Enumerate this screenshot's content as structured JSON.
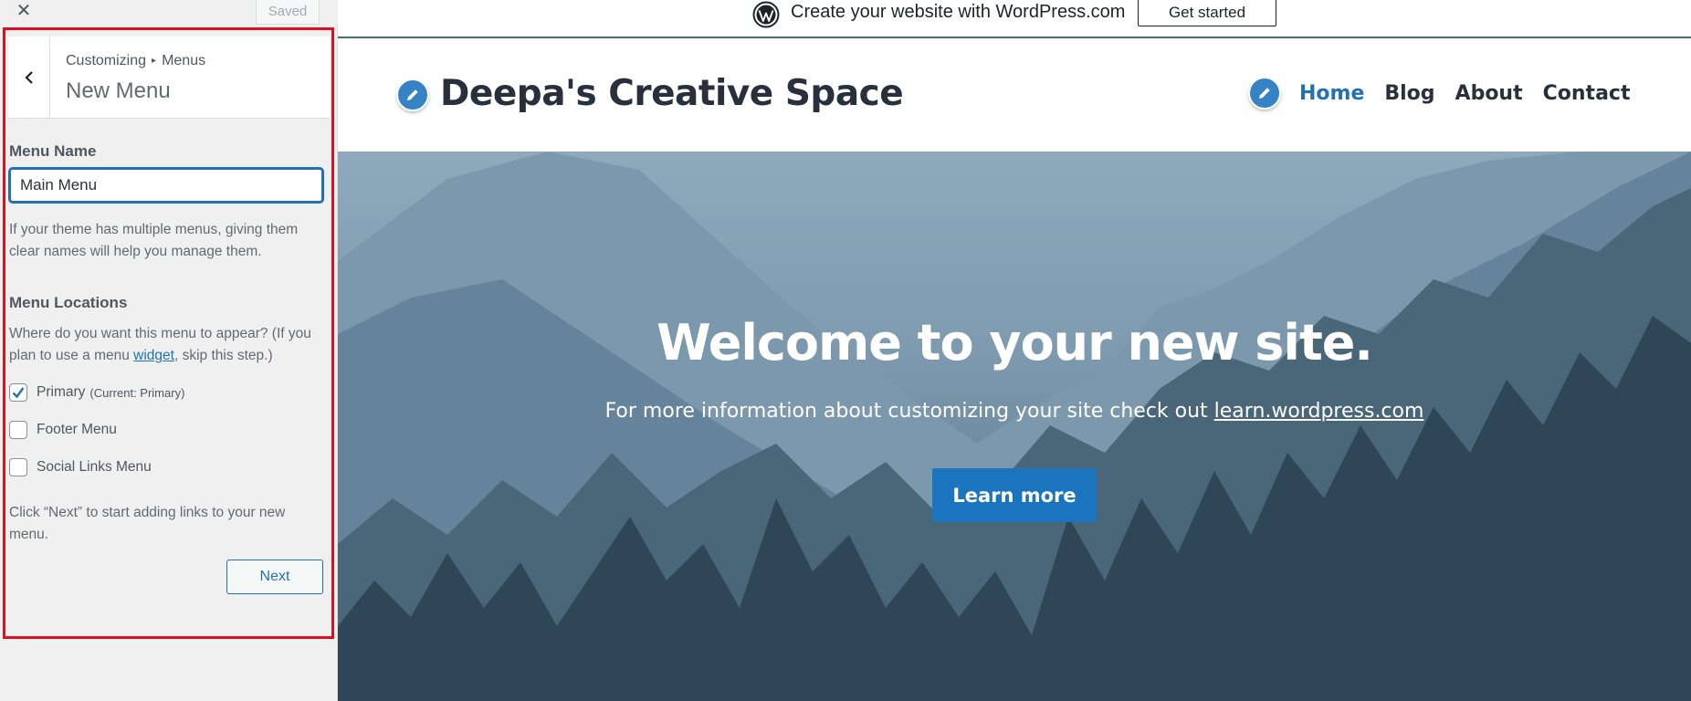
{
  "topbar": {
    "close_icon": "close-icon",
    "saved_label": "Saved"
  },
  "section": {
    "breadcrumb_root": "Customizing",
    "breadcrumb_separator": "▸",
    "breadcrumb_current": "Menus",
    "title": "New Menu"
  },
  "menu_name": {
    "label": "Menu Name",
    "value": "Main Menu",
    "help": "If your theme has multiple menus, giving them clear names will help you manage them."
  },
  "menu_locations": {
    "label": "Menu Locations",
    "help_before": "Where do you want this menu to appear? (If you plan to use a menu ",
    "help_link": "widget",
    "help_after": ", skip this step.)",
    "options": [
      {
        "label": "Primary",
        "note": "(Current: Primary)",
        "checked": true
      },
      {
        "label": "Footer Menu",
        "note": "",
        "checked": false
      },
      {
        "label": "Social Links Menu",
        "note": "",
        "checked": false
      }
    ]
  },
  "next_help": "Click “Next” to start adding links to your new menu.",
  "next_label": "Next",
  "wpcom_bar": {
    "text": "Create your website with WordPress.com",
    "button": "Get started"
  },
  "site": {
    "title": "Deepa's Creative Space",
    "nav": [
      "Home",
      "Blog",
      "About",
      "Contact"
    ],
    "active_nav": "Home"
  },
  "hero": {
    "title": "Welcome to your new site.",
    "subtitle_before": "For more information about customizing your site check out ",
    "subtitle_link": "learn.wordpress.com",
    "button": "Learn more"
  },
  "colors": {
    "accent": "#2271b1",
    "highlight": "#e0101e",
    "button_blue": "#1b75be"
  }
}
